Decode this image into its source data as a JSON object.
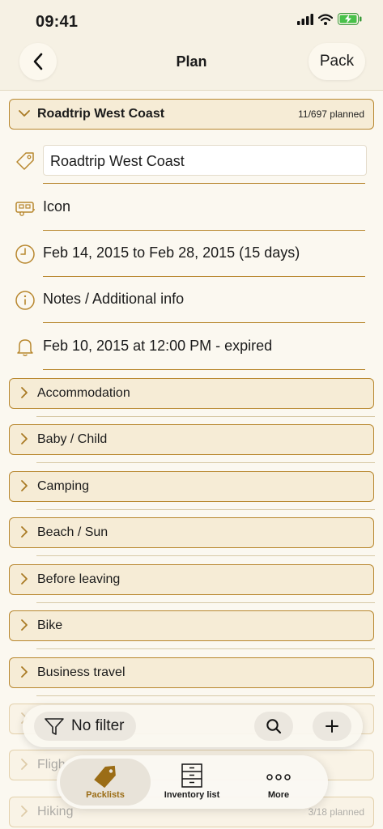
{
  "status": {
    "time": "09:41"
  },
  "nav": {
    "title": "Plan",
    "pack_label": "Pack"
  },
  "trip": {
    "title": "Roadtrip West Coast",
    "count": "11/697 planned",
    "name_value": "Roadtrip West Coast",
    "icon_label": "Icon",
    "dates": "Feb 14, 2015 to Feb 28, 2015 (15 days)",
    "notes": "Notes / Additional info",
    "reminder": "Feb 10, 2015 at 12:00 PM - expired"
  },
  "categories": [
    {
      "label": "Accommodation",
      "count": ""
    },
    {
      "label": "Baby / Child",
      "count": ""
    },
    {
      "label": "Camping",
      "count": ""
    },
    {
      "label": "Beach / Sun",
      "count": ""
    },
    {
      "label": "Before leaving",
      "count": ""
    },
    {
      "label": "Bike",
      "count": ""
    },
    {
      "label": "Business travel",
      "count": ""
    },
    {
      "label": "",
      "count": ""
    },
    {
      "label": "Fligh",
      "count": ""
    },
    {
      "label": "Hiking",
      "count": "3/18 planned"
    }
  ],
  "toolbar": {
    "filter_label": "No filter"
  },
  "tabs": [
    {
      "label": "Packlists"
    },
    {
      "label": "Inventory list"
    },
    {
      "label": "More"
    }
  ],
  "colors": {
    "accent": "#b8872e",
    "background": "#fbf8f0",
    "header_fill": "#f6ecd6"
  }
}
